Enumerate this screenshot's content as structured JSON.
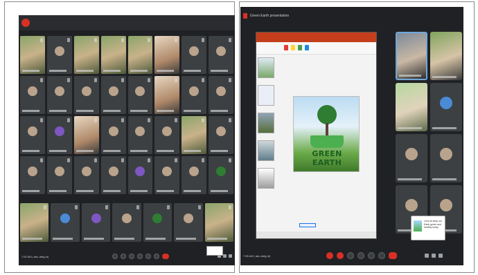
{
  "left_window": {
    "title": "",
    "bottom_time": "7:52 AM | abc-defg-hij",
    "grid_tiles": [
      {
        "kind": "video"
      },
      {
        "kind": "avatar"
      },
      {
        "kind": "video"
      },
      {
        "kind": "video"
      },
      {
        "kind": "video"
      },
      {
        "kind": "video2"
      },
      {
        "kind": "avatar"
      },
      {
        "kind": "avatar"
      },
      {
        "kind": "avatar"
      },
      {
        "kind": "avatar"
      },
      {
        "kind": "avatar"
      },
      {
        "kind": "avatar"
      },
      {
        "kind": "avatar"
      },
      {
        "kind": "video2"
      },
      {
        "kind": "avatar"
      },
      {
        "kind": "avatar"
      },
      {
        "kind": "avatar"
      },
      {
        "kind": "avatar",
        "color": "purple"
      },
      {
        "kind": "video2"
      },
      {
        "kind": "avatar"
      },
      {
        "kind": "avatar"
      },
      {
        "kind": "avatar"
      },
      {
        "kind": "video"
      },
      {
        "kind": "avatar"
      },
      {
        "kind": "avatar"
      },
      {
        "kind": "avatar"
      },
      {
        "kind": "avatar"
      },
      {
        "kind": "avatar"
      },
      {
        "kind": "avatar",
        "color": "purple"
      },
      {
        "kind": "avatar"
      },
      {
        "kind": "avatar"
      },
      {
        "kind": "avatar",
        "color": "green"
      }
    ],
    "last_row": [
      {
        "kind": "video"
      },
      {
        "kind": "avatar",
        "color": "blue"
      },
      {
        "kind": "avatar",
        "color": "purple"
      },
      {
        "kind": "avatar"
      },
      {
        "kind": "avatar",
        "color": "green"
      },
      {
        "kind": "avatar"
      },
      {
        "kind": "video"
      }
    ]
  },
  "right_window": {
    "title": "Green Earth presentation",
    "bottom_time": "7:55 AM | abc-defg-hij",
    "slide_title": "GREEN EARTH",
    "popup_text": "Let's all keep our Earth green and healthy today",
    "side_tiles": [
      {
        "kind": "video-hl"
      },
      {
        "kind": "video"
      },
      {
        "kind": "video3"
      },
      {
        "kind": "avatar",
        "color": "blue"
      },
      {
        "kind": "avatar"
      },
      {
        "kind": "avatar"
      },
      {
        "kind": "avatar"
      },
      {
        "kind": "avatar"
      }
    ]
  },
  "colors": {
    "meet_bg": "#202124",
    "tile_bg": "#3c4043",
    "end_call": "#d93025",
    "ppt_ribbon": "#c43e1c",
    "slide_title": "#1b5e20"
  }
}
